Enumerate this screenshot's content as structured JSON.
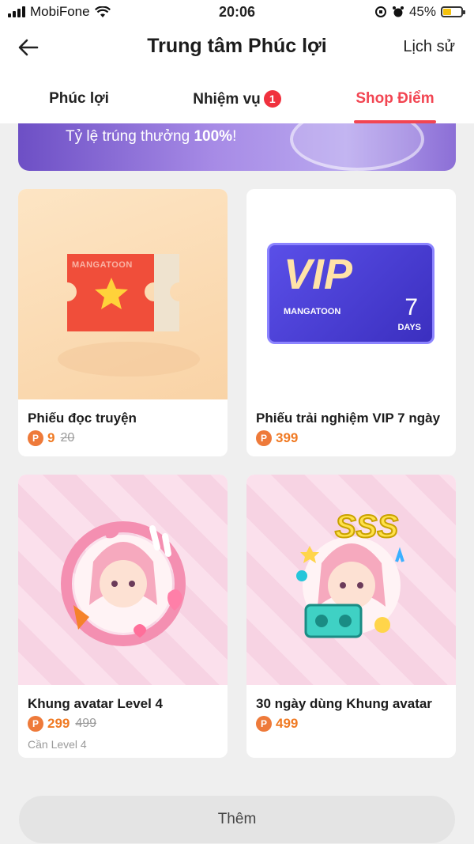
{
  "status": {
    "carrier": "MobiFone",
    "time": "20:06",
    "battery": "45%",
    "battery_level": 0.45
  },
  "header": {
    "title": "Trung tâm Phúc lợi",
    "history": "Lịch sử"
  },
  "tabs": [
    {
      "label": "Phúc lợi"
    },
    {
      "label": "Nhiệm vụ",
      "badge": "1"
    },
    {
      "label": "Shop Điểm",
      "active": true
    }
  ],
  "banner": {
    "text_prefix": "Tỷ lệ trúng thưởng ",
    "text_bold": "100%",
    "text_suffix": "!"
  },
  "items": [
    {
      "name": "Phiếu đọc truyện",
      "coin": "P",
      "price": "9",
      "old_price": "20",
      "thumb_text": "MANGATOON"
    },
    {
      "name": "Phiếu trải nghiệm VIP 7 ngày",
      "coin": "P",
      "price": "399",
      "thumb_title": "VIP",
      "thumb_brand": "MANGATOON",
      "thumb_days_num": "7",
      "thumb_days_label": "DAYS"
    },
    {
      "name": "Khung avatar Level 4",
      "coin": "P",
      "price": "299",
      "old_price": "499",
      "requirement": "Cần Level 4"
    },
    {
      "name": "30 ngày dùng Khung avatar",
      "coin": "P",
      "price": "499",
      "thumb_text": "SSS"
    }
  ],
  "more_button": "Thêm",
  "colors": {
    "accent": "#f24552",
    "price": "#f07a23",
    "vip": "#4b3fd6"
  }
}
